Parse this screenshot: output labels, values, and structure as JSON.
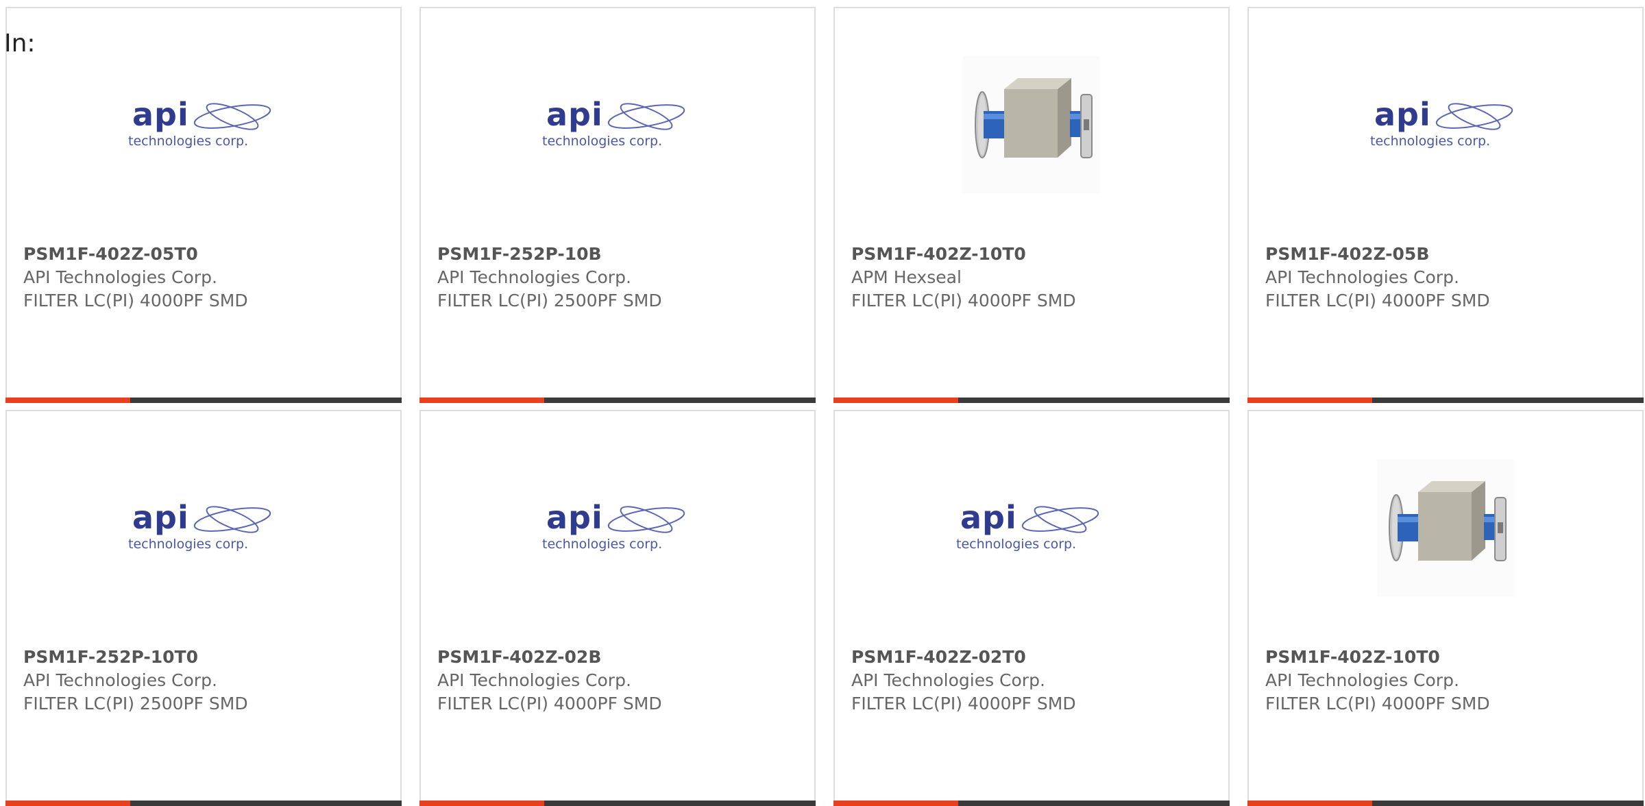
{
  "prefix_text": "In:",
  "colors": {
    "accent": "#e8401c",
    "bar": "#3a3a3a",
    "card_border": "#dddddd",
    "logo_blue": "#2f3b8f",
    "text_gray": "#555555"
  },
  "products": [
    {
      "image": "api-logo",
      "part_number": "PSM1F-402Z-05T0",
      "manufacturer": "API Technologies Corp.",
      "description": "FILTER LC(PI) 4000PF SMD"
    },
    {
      "image": "api-logo",
      "part_number": "PSM1F-252P-10B",
      "manufacturer": "API Technologies Corp.",
      "description": "FILTER LC(PI) 2500PF SMD"
    },
    {
      "image": "component-photo",
      "part_number": "PSM1F-402Z-10T0",
      "manufacturer": "APM Hexseal",
      "description": "FILTER LC(PI) 4000PF SMD"
    },
    {
      "image": "api-logo",
      "part_number": "PSM1F-402Z-05B",
      "manufacturer": "API Technologies Corp.",
      "description": "FILTER LC(PI) 4000PF SMD"
    },
    {
      "image": "api-logo",
      "part_number": "PSM1F-252P-10T0",
      "manufacturer": "API Technologies Corp.",
      "description": "FILTER LC(PI) 2500PF SMD"
    },
    {
      "image": "api-logo",
      "part_number": "PSM1F-402Z-02B",
      "manufacturer": "API Technologies Corp.",
      "description": "FILTER LC(PI) 4000PF SMD"
    },
    {
      "image": "api-logo",
      "part_number": "PSM1F-402Z-02T0",
      "manufacturer": "API Technologies Corp.",
      "description": "FILTER LC(PI) 4000PF SMD"
    },
    {
      "image": "component-photo",
      "part_number": "PSM1F-402Z-10T0",
      "manufacturer": "API Technologies Corp.",
      "description": "FILTER LC(PI) 4000PF SMD"
    }
  ],
  "logo": {
    "word": "api",
    "tagline": "technologies corp."
  }
}
